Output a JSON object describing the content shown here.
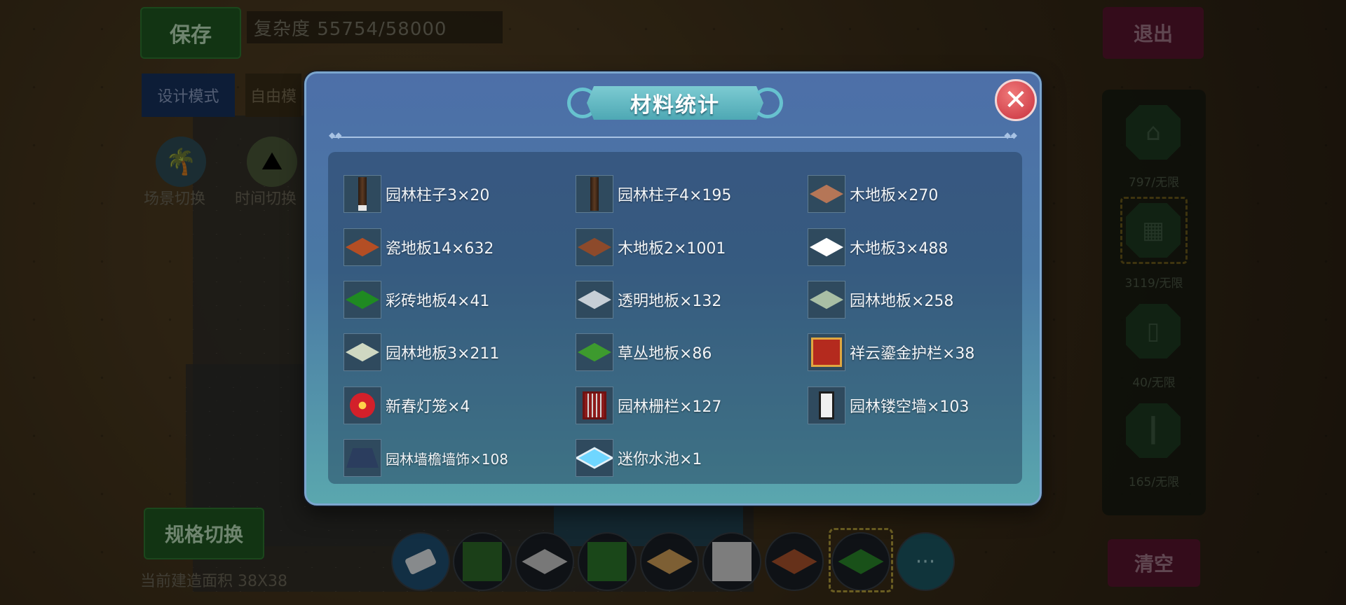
{
  "hud": {
    "save_label": "保存",
    "complexity_text": "复杂度 55754/58000",
    "exit_label": "退出",
    "design_mode_label": "设计模式",
    "free_mode_label": "自由模",
    "scene_switch_label": "场景切换",
    "time_switch_label": "时间切换",
    "spec_switch_label": "规格切换",
    "area_label": "当前建造面积 38X38",
    "clear_label": "清空"
  },
  "right_panel": {
    "counts": [
      "797/无限",
      "3119/无限",
      "40/无限",
      "165/无限"
    ]
  },
  "modal": {
    "title": "材料统计",
    "close_symbol": "✕",
    "materials": [
      {
        "label": "园林柱子3×20",
        "icon": "pillar-icon"
      },
      {
        "label": "园林柱子4×195",
        "icon": "pillar-icon"
      },
      {
        "label": "木地板×270",
        "icon": "wood-floor-icon"
      },
      {
        "label": "瓷地板14×632",
        "icon": "ceramic-floor-icon"
      },
      {
        "label": "木地板2×1001",
        "icon": "wood-floor-icon"
      },
      {
        "label": "木地板3×488",
        "icon": "white-floor-icon"
      },
      {
        "label": "彩砖地板4×41",
        "icon": "green-tile-icon"
      },
      {
        "label": "透明地板×132",
        "icon": "transparent-floor-icon"
      },
      {
        "label": "园林地板×258",
        "icon": "garden-floor-icon"
      },
      {
        "label": "园林地板3×211",
        "icon": "garden-floor-icon"
      },
      {
        "label": "草丛地板×86",
        "icon": "grass-floor-icon"
      },
      {
        "label": "祥云鎏金护栏×38",
        "icon": "railing-icon"
      },
      {
        "label": "新春灯笼×4",
        "icon": "lantern-icon"
      },
      {
        "label": "园林栅栏×127",
        "icon": "fence-icon"
      },
      {
        "label": "园林镂空墙×103",
        "icon": "lattice-wall-icon"
      },
      {
        "label": "园林墙檐墙饰×108",
        "icon": "eave-decoration-icon"
      },
      {
        "label": "迷你水池×1",
        "icon": "pool-icon"
      }
    ]
  },
  "toolbar": {
    "more_label": "···"
  }
}
